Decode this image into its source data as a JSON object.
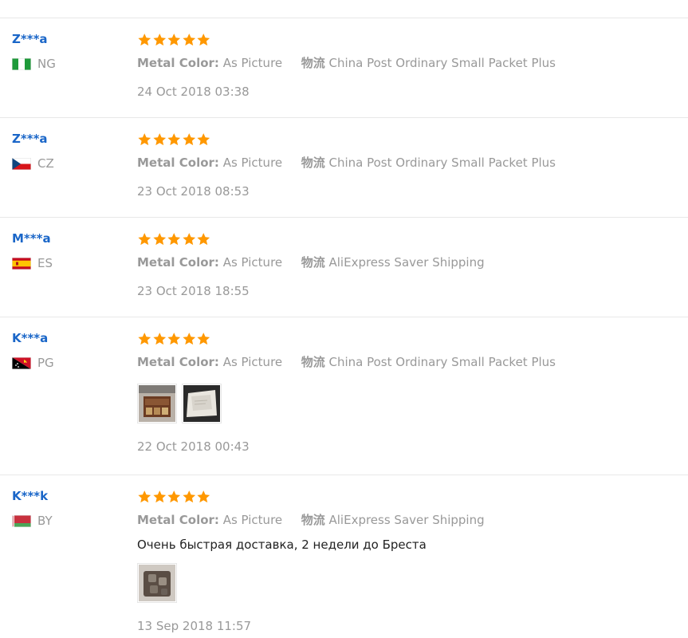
{
  "labels": {
    "metal_color_key": "Metal Color:",
    "logistics_key": "物流"
  },
  "colors": {
    "star": "#ff9800",
    "username": "#1a66c8"
  },
  "reviews": [
    {
      "user": "Z***a",
      "country": "NG",
      "flag": "flag-ng-icon",
      "rating": 5,
      "metal_color": "As Picture",
      "shipping": "China Post Ordinary Small Packet Plus",
      "date": "24 Oct 2018 03:38"
    },
    {
      "user": "Z***a",
      "country": "CZ",
      "flag": "flag-cz-icon",
      "rating": 5,
      "metal_color": "As Picture",
      "shipping": "China Post Ordinary Small Packet Plus",
      "date": "23 Oct 2018 08:53"
    },
    {
      "user": "M***a",
      "country": "ES",
      "flag": "flag-es-icon",
      "rating": 5,
      "metal_color": "As Picture",
      "shipping": "AliExpress Saver Shipping",
      "date": "23 Oct 2018 18:55"
    },
    {
      "user": "K***a",
      "country": "PG",
      "flag": "flag-pg-icon",
      "rating": 5,
      "metal_color": "As Picture",
      "shipping": "China Post Ordinary Small Packet Plus",
      "photos": [
        "photo-wooden-box",
        "photo-white-packet"
      ],
      "date": "22 Oct 2018 00:43"
    },
    {
      "user": "K***k",
      "country": "BY",
      "flag": "flag-by-icon",
      "rating": 5,
      "metal_color": "As Picture",
      "shipping": "AliExpress Saver Shipping",
      "comment": "Очень быстрая доставка, 2 недели до Бреста",
      "photos": [
        "photo-item-in-hand"
      ],
      "date": "13 Sep 2018 11:57"
    }
  ]
}
